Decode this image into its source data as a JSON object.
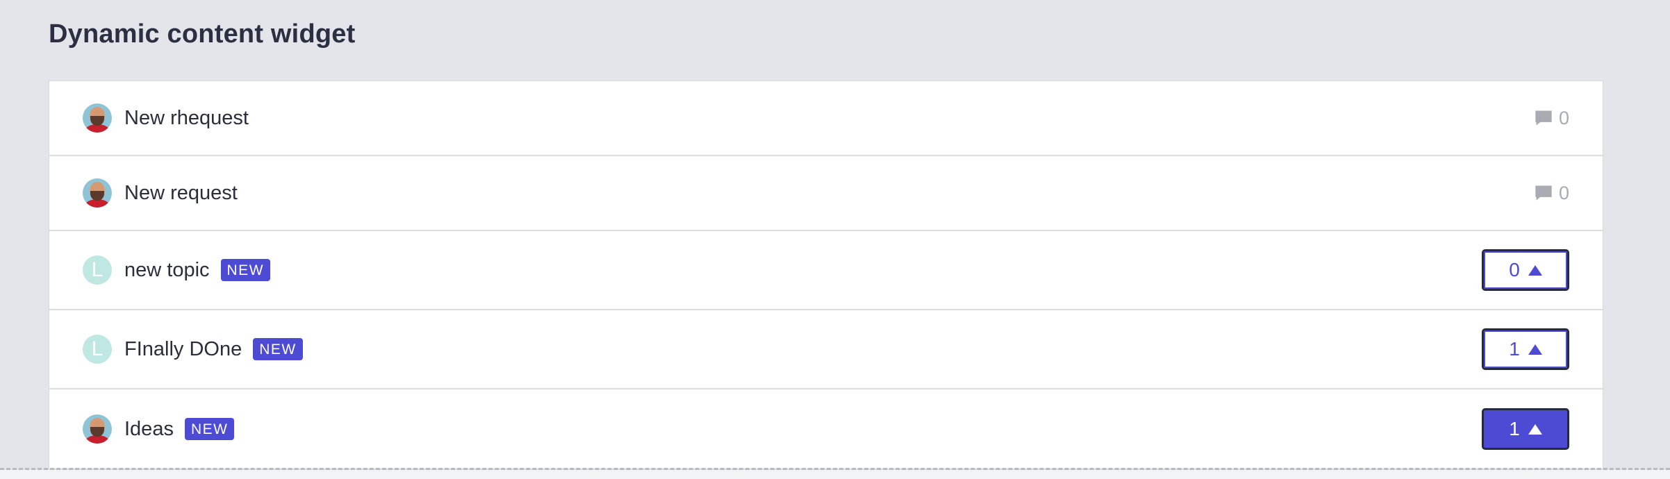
{
  "widget": {
    "title": "Dynamic content widget"
  },
  "items": [
    {
      "avatar": "photo",
      "title": "New rhequest",
      "badge": "",
      "meta": "comments",
      "count": "0"
    },
    {
      "avatar": "photo",
      "title": "New request",
      "badge": "",
      "meta": "comments",
      "count": "0"
    },
    {
      "avatar": "L",
      "title": "new topic",
      "badge": "NEW",
      "meta": "votes",
      "count": "0",
      "voted": false
    },
    {
      "avatar": "L",
      "title": "FInally DOne",
      "badge": "NEW",
      "meta": "votes",
      "count": "1",
      "voted": false
    },
    {
      "avatar": "photo",
      "title": "Ideas",
      "badge": "NEW",
      "meta": "votes",
      "count": "1",
      "voted": true
    }
  ],
  "colors": {
    "accent": "#4d4bd3",
    "background": "#e4e5ea",
    "avatar_letter_bg": "#bfe8e2"
  },
  "icons": {
    "comments": "speech-bubble-icon",
    "vote": "triangle-up-icon"
  }
}
